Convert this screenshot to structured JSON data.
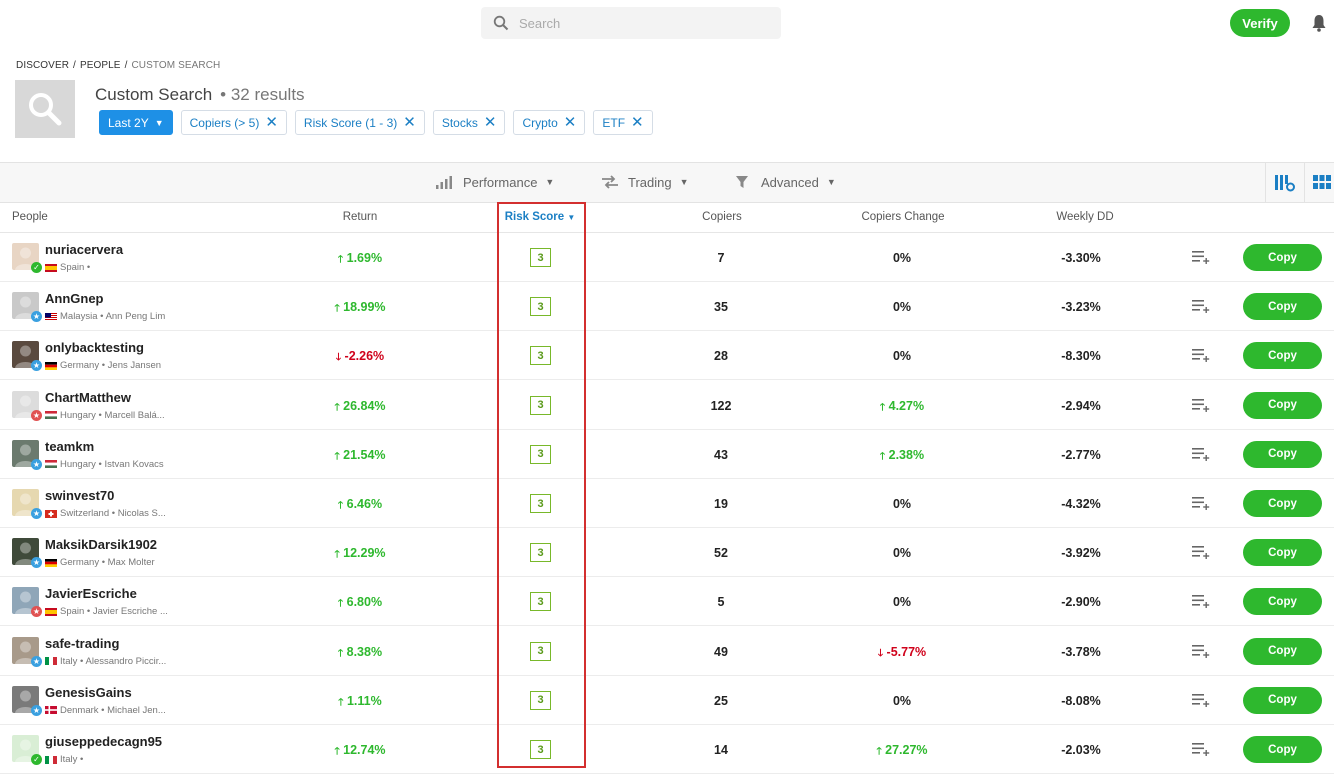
{
  "search": {
    "placeholder": "Search"
  },
  "header": {
    "verify_label": "Verify"
  },
  "breadcrumb": [
    "DISCOVER",
    "PEOPLE",
    "CUSTOM SEARCH"
  ],
  "page": {
    "title": "Custom Search",
    "results": "• 32 results"
  },
  "filters": {
    "period": "Last 2Y",
    "chips": [
      "Copiers (> 5)",
      "Risk Score (1 - 3)",
      "Stocks",
      "Crypto",
      "ETF"
    ]
  },
  "tabs": [
    "Performance",
    "Trading",
    "Advanced"
  ],
  "columns": {
    "people": "People",
    "return": "Return",
    "risk": "Risk Score",
    "copiers": "Copiers",
    "copiers_change": "Copiers Change",
    "weekly_dd": "Weekly DD"
  },
  "copy_label": "Copy",
  "rows": [
    {
      "name": "nuriacervera",
      "sub": "Spain •",
      "flag": "es",
      "badge": "check",
      "ret": "1.69%",
      "ret_dir": "up",
      "risk": "3",
      "copiers": "7",
      "change": "0%",
      "change_dir": "none",
      "dd": "-3.30%",
      "av": "#e8d5c4"
    },
    {
      "name": "AnnGnep",
      "sub": "Malaysia • Ann Peng Lim",
      "flag": "my",
      "badge": "star",
      "ret": "18.99%",
      "ret_dir": "up",
      "risk": "3",
      "copiers": "35",
      "change": "0%",
      "change_dir": "none",
      "dd": "-3.23%",
      "av": "#c9c9c9"
    },
    {
      "name": "onlybacktesting",
      "sub": "Germany • Jens Jansen",
      "flag": "de",
      "badge": "star",
      "ret": "-2.26%",
      "ret_dir": "down",
      "risk": "3",
      "copiers": "28",
      "change": "0%",
      "change_dir": "none",
      "dd": "-8.30%",
      "av": "#5a4a3f"
    },
    {
      "name": "ChartMatthew",
      "sub": "Hungary • Marcell Balá...",
      "flag": "hu",
      "badge": "star-red",
      "ret": "26.84%",
      "ret_dir": "up",
      "risk": "3",
      "copiers": "122",
      "change": "4.27%",
      "change_dir": "up",
      "dd": "-2.94%",
      "av": "#dcdcdc"
    },
    {
      "name": "teamkm",
      "sub": "Hungary • Istvan Kovacs",
      "flag": "hu",
      "badge": "star",
      "ret": "21.54%",
      "ret_dir": "up",
      "risk": "3",
      "copiers": "43",
      "change": "2.38%",
      "change_dir": "up",
      "dd": "-2.77%",
      "av": "#6b7a6e"
    },
    {
      "name": "swinvest70",
      "sub": "Switzerland • Nicolas S...",
      "flag": "ch",
      "badge": "star",
      "ret": "6.46%",
      "ret_dir": "up",
      "risk": "3",
      "copiers": "19",
      "change": "0%",
      "change_dir": "none",
      "dd": "-4.32%",
      "av": "#e6d8b0"
    },
    {
      "name": "MaksikDarsik1902",
      "sub": "Germany • Max Molter",
      "flag": "de",
      "badge": "star",
      "ret": "12.29%",
      "ret_dir": "up",
      "risk": "3",
      "copiers": "52",
      "change": "0%",
      "change_dir": "none",
      "dd": "-3.92%",
      "av": "#3f4a3a"
    },
    {
      "name": "JavierEscriche",
      "sub": "Spain • Javier Escriche ...",
      "flag": "es",
      "badge": "star-red",
      "ret": "6.80%",
      "ret_dir": "up",
      "risk": "3",
      "copiers": "5",
      "change": "0%",
      "change_dir": "none",
      "dd": "-2.90%",
      "av": "#8fa6b8"
    },
    {
      "name": "safe-trading",
      "sub": "Italy • Alessandro Piccir...",
      "flag": "it",
      "badge": "star",
      "ret": "8.38%",
      "ret_dir": "up",
      "risk": "3",
      "copiers": "49",
      "change": "-5.77%",
      "change_dir": "down",
      "dd": "-3.78%",
      "av": "#a89a8a"
    },
    {
      "name": "GenesisGains",
      "sub": "Denmark • Michael Jen...",
      "flag": "dk",
      "badge": "star",
      "ret": "1.11%",
      "ret_dir": "up",
      "risk": "3",
      "copiers": "25",
      "change": "0%",
      "change_dir": "none",
      "dd": "-8.08%",
      "av": "#7a7a7a"
    },
    {
      "name": "giuseppedecagn95",
      "sub": "Italy •",
      "flag": "it",
      "badge": "check",
      "ret": "12.74%",
      "ret_dir": "up",
      "risk": "3",
      "copiers": "14",
      "change": "27.27%",
      "change_dir": "up",
      "dd": "-2.03%",
      "av": "#d9eed5"
    }
  ]
}
